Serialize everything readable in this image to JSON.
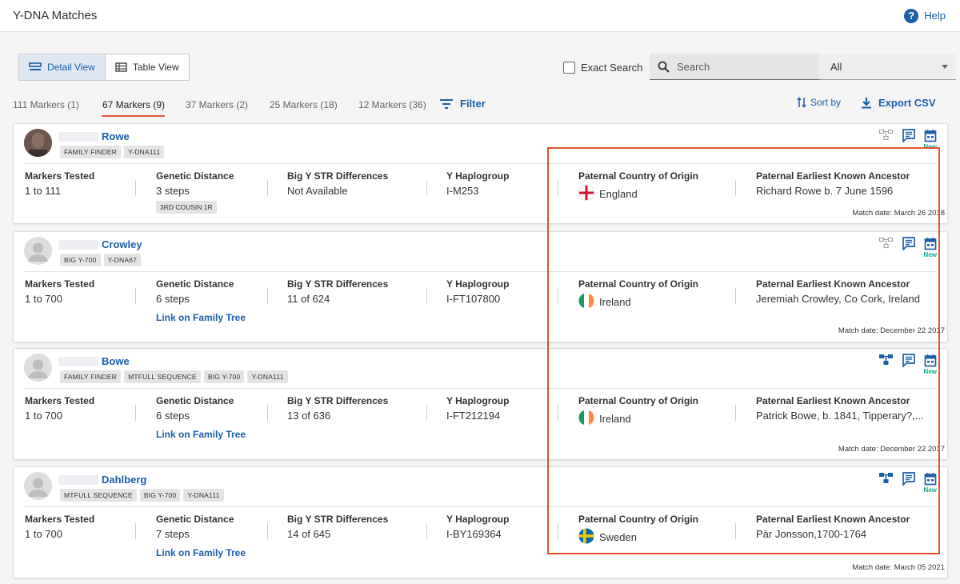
{
  "app": {
    "title": "Y-DNA Matches",
    "help": "Help"
  },
  "views": {
    "detail": "Detail View",
    "table": "Table View"
  },
  "search": {
    "exact_label": "Exact Search",
    "placeholder": "Search",
    "filter_value": "All"
  },
  "tabs": [
    {
      "label": "111 Markers (1)",
      "active": false
    },
    {
      "label": "67 Markers (9)",
      "active": true
    },
    {
      "label": "37 Markers (2)",
      "active": false
    },
    {
      "label": "25 Markers (18)",
      "active": false
    },
    {
      "label": "12 Markers (36)",
      "active": false
    }
  ],
  "actions": {
    "filter": "Filter",
    "sort": "Sort by",
    "export": "Export CSV"
  },
  "headers": {
    "markers": "Markers Tested",
    "distance": "Genetic Distance",
    "bigy": "Big Y STR Differences",
    "haplo": "Y Haplogroup",
    "country": "Paternal Country of Origin",
    "ancestor": "Paternal Earliest Known Ancestor"
  },
  "icon_labels": {
    "new": "New"
  },
  "matches": [
    {
      "surname": "Rowe",
      "avatar": "photo",
      "tests": [
        "FAMILY FINDER",
        "Y-DNA111"
      ],
      "markers": "1 to 111",
      "distance": "3 steps",
      "relationship": "3RD COUSIN 1R",
      "family_tree": "",
      "bigy": "Not Available",
      "haplogroup": "I-M253",
      "country": "England",
      "flag": "england-flag",
      "ancestor": "Richard Rowe b. 7 June 1596",
      "match_date": "Match date: March 26 2018",
      "tree_icon_active": false
    },
    {
      "surname": "Crowley",
      "avatar": "silhouette",
      "tests": [
        "BIG Y-700",
        "Y-DNA67"
      ],
      "markers": "1 to 700",
      "distance": "6 steps",
      "relationship": "",
      "family_tree": "Link on Family Tree",
      "bigy": "11 of 624",
      "haplogroup": "I-FT107800",
      "country": "Ireland",
      "flag": "ireland-flag",
      "ancestor": "Jeremiah Crowley, Co Cork, Ireland",
      "match_date": "Match date: December 22 2017",
      "tree_icon_active": false
    },
    {
      "surname": "Bowe",
      "avatar": "silhouette",
      "tests": [
        "FAMILY FINDER",
        "MTFULL SEQUENCE",
        "BIG Y-700",
        "Y-DNA111"
      ],
      "markers": "1 to 700",
      "distance": "6 steps",
      "relationship": "",
      "family_tree": "Link on Family Tree",
      "bigy": "13 of 636",
      "haplogroup": "I-FT212194",
      "country": "Ireland",
      "flag": "ireland-flag",
      "ancestor": "Patrick Bowe, b. 1841, Tipperary?,...",
      "match_date": "Match date: December 22 2017",
      "tree_icon_active": true
    },
    {
      "surname": "Dahlberg",
      "avatar": "silhouette",
      "tests": [
        "MTFULL SEQUENCE",
        "BIG Y-700",
        "Y-DNA111"
      ],
      "markers": "1 to 700",
      "distance": "7 steps",
      "relationship": "",
      "family_tree": "Link on Family Tree",
      "bigy": "14 of 645",
      "haplogroup": "I-BY169364",
      "country": "Sweden",
      "flag": "sweden-flag",
      "ancestor": "Pär Jonsson,1700-1764",
      "match_date": "Match date: March 05 2021",
      "tree_icon_active": true
    }
  ],
  "colors": {
    "accent": "#1b5fa8",
    "tab_underline": "#e3593b",
    "highlight": "#e6502e",
    "new": "#13a58f"
  }
}
